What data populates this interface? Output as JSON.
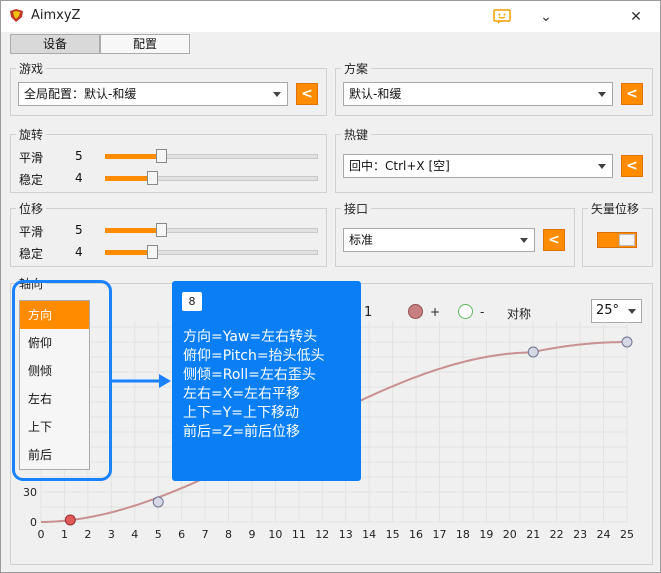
{
  "window": {
    "title": "AimxyZ",
    "minimize": "⌄",
    "close": "✕"
  },
  "tabs": [
    {
      "label": "设备"
    },
    {
      "label": "配置"
    }
  ],
  "game": {
    "title": "游戏",
    "value": "全局配置：默认-和缓",
    "button": "<"
  },
  "scheme": {
    "title": "方案",
    "value": "默认-和缓",
    "button": "<"
  },
  "rotation": {
    "title": "旋转",
    "rows": [
      {
        "label": "平滑",
        "value": "5",
        "level": 0.265
      },
      {
        "label": "稳定",
        "value": "4",
        "level": 0.22
      }
    ]
  },
  "hotkey": {
    "title": "热键",
    "value": "回中：Ctrl+X [空]",
    "button": "<"
  },
  "displacement": {
    "title": "位移",
    "rows": [
      {
        "label": "平滑",
        "value": "5",
        "level": 0.265
      },
      {
        "label": "稳定",
        "value": "4",
        "level": 0.22
      }
    ]
  },
  "interface": {
    "title": "接口",
    "value": "标准",
    "button": "<"
  },
  "vector": {
    "title": "矢量位移",
    "on": true
  },
  "axis": {
    "title": "轴向",
    "menu": [
      "方向",
      "俯仰",
      "侧倾",
      "左右",
      "上下",
      "前后"
    ],
    "selected": 0,
    "legend_plus": "+",
    "legend_minus": "-",
    "symmetry_label": "对称",
    "angle_value": "25°",
    "partial_value": "1"
  },
  "tooltip": {
    "badge": "8",
    "lines": [
      "方向=Yaw=左右转头",
      "俯仰=Pitch=抬头低头",
      "侧倾=Roll=左右歪头",
      "左右=X=左右平移",
      "上下=Y=上下移动",
      "前后=Z=前后位移"
    ]
  },
  "chart_data": {
    "type": "line",
    "x_ticks": [
      "0",
      "1",
      "2",
      "3",
      "4",
      "5",
      "6",
      "7",
      "8",
      "9",
      "10",
      "11",
      "12",
      "13",
      "14",
      "15",
      "16",
      "17",
      "18",
      "19",
      "20",
      "21",
      "22",
      "23",
      "24",
      "25"
    ],
    "y_ticks_visible": [
      "0",
      "30"
    ],
    "xlim": [
      0,
      25
    ],
    "grid": true,
    "curve_color": "#c89090",
    "control_points": [
      {
        "x": 1.25,
        "y": 2,
        "kind": "plus"
      },
      {
        "x": 5,
        "y": 20,
        "kind": "minus"
      },
      {
        "x": 21,
        "y": 170,
        "kind": "minus"
      },
      {
        "x": 25,
        "y": 180,
        "kind": "minus"
      }
    ]
  },
  "colors": {
    "accent": "#ff8c00",
    "highlight_blue": "#0a7ff5"
  }
}
